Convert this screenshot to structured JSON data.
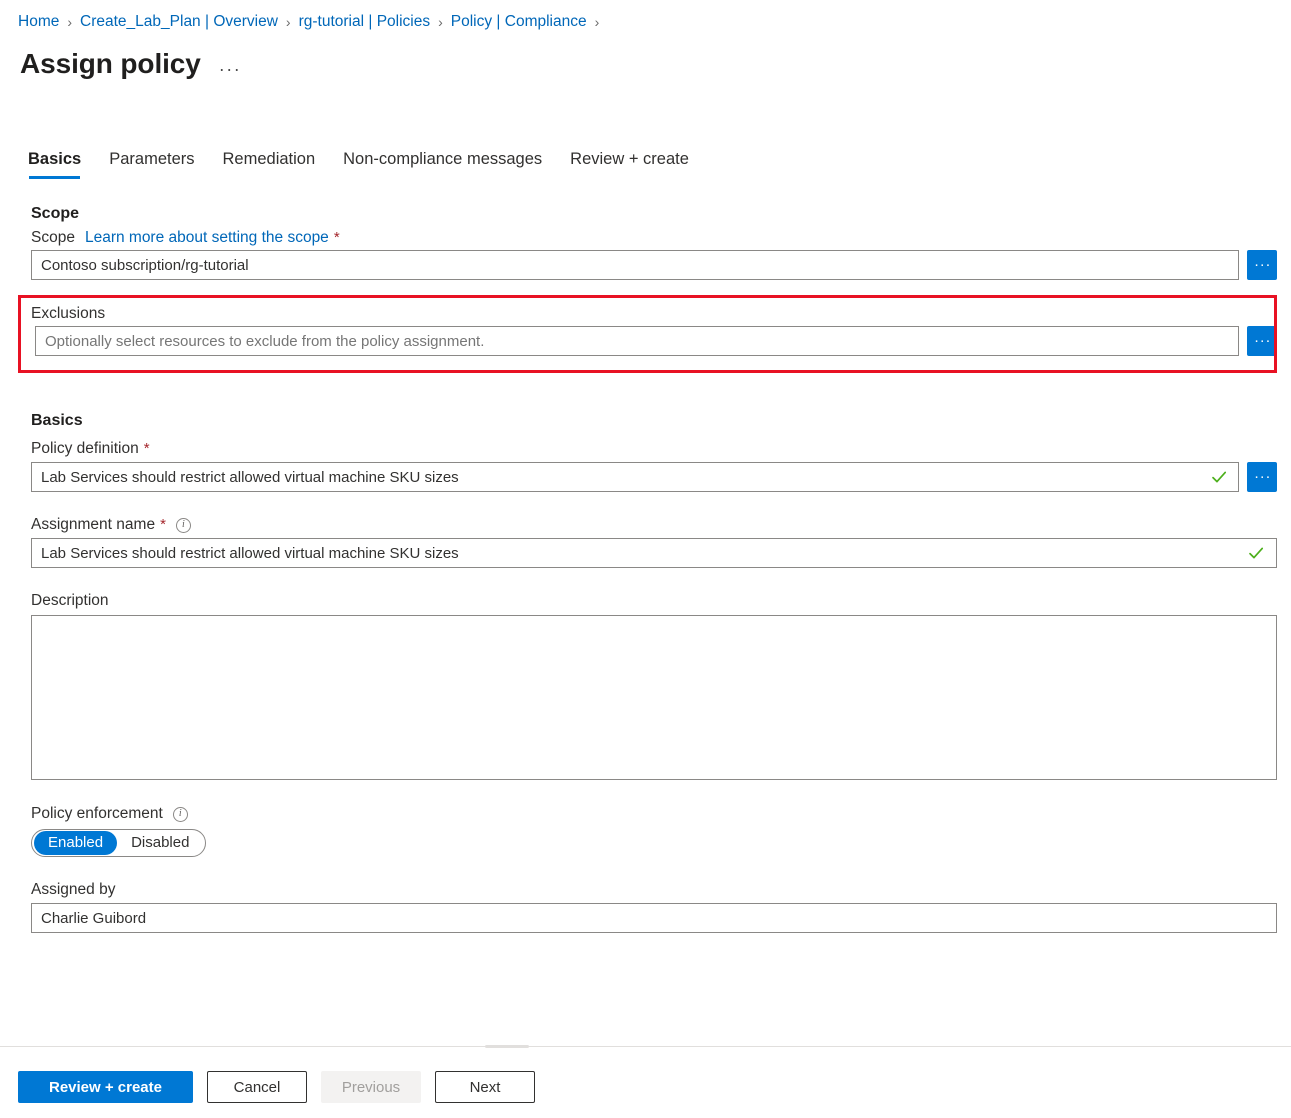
{
  "breadcrumb": {
    "items": [
      {
        "label": "Home"
      },
      {
        "label": "Create_Lab_Plan | Overview"
      },
      {
        "label": "rg-tutorial | Policies"
      },
      {
        "label": "Policy | Compliance"
      }
    ],
    "separator": "›"
  },
  "header": {
    "title": "Assign policy",
    "more_label": "···"
  },
  "tabs": [
    {
      "label": "Basics",
      "active": true
    },
    {
      "label": "Parameters",
      "active": false
    },
    {
      "label": "Remediation",
      "active": false
    },
    {
      "label": "Non-compliance messages",
      "active": false
    },
    {
      "label": "Review + create",
      "active": false
    }
  ],
  "scope_section": {
    "heading": "Scope",
    "scope_label": "Scope",
    "scope_link": "Learn more about setting the scope",
    "required_mark": "*",
    "scope_value": "Contoso subscription/rg-tutorial",
    "scope_browse_label": "...",
    "exclusions_label": "Exclusions",
    "exclusions_value": "",
    "exclusions_placeholder": "Optionally select resources to exclude from the policy assignment.",
    "exclusions_browse_label": "..."
  },
  "basics_section": {
    "heading": "Basics",
    "policy_definition_label": "Policy definition",
    "policy_definition_value": "Lab Services should restrict allowed virtual machine SKU sizes",
    "policy_definition_browse_label": "...",
    "assignment_name_label": "Assignment name",
    "assignment_name_value": "Lab Services should restrict allowed virtual machine SKU sizes",
    "assignment_info_glyph": "i",
    "description_label": "Description",
    "description_value": "",
    "policy_enforcement_label": "Policy enforcement",
    "policy_enforcement_info_glyph": "i",
    "policy_enforcement_options": [
      {
        "label": "Enabled",
        "selected": true
      },
      {
        "label": "Disabled",
        "selected": false
      }
    ],
    "assigned_by_label": "Assigned by",
    "assigned_by_value": "Charlie Guibord"
  },
  "footer": {
    "review_create_label": "Review + create",
    "cancel_label": "Cancel",
    "previous_label": "Previous",
    "next_label": "Next"
  },
  "colors": {
    "accent": "#0078d4",
    "link": "#0067b8",
    "required": "#a4262c",
    "highlight": "#e81123",
    "validation_check": "#4caf1b"
  }
}
